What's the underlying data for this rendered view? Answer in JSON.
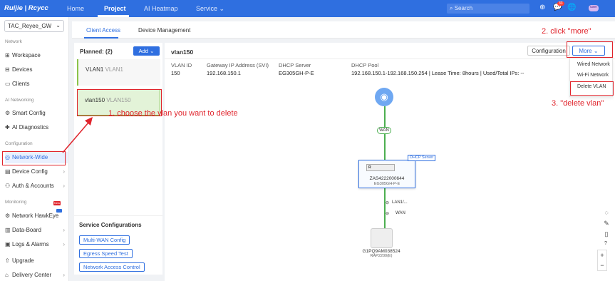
{
  "header": {
    "logo": "Ruijie | Rcycc",
    "nav": [
      "Home",
      "Project",
      "AI Heatmap",
      "Service"
    ],
    "search_placeholder": "Search",
    "notification_count": "33",
    "avatar_text": "user"
  },
  "sidebar": {
    "project_select": "TAC_Reyee_GW",
    "sections": {
      "network": "Network",
      "ai": "AI Networking",
      "configuration": "Configuration",
      "monitoring": "Monitoring"
    },
    "items": {
      "workspace": "Workspace",
      "devices": "Devices",
      "clients": "Clients",
      "smart_config": "Smart Config",
      "ai_diagnostics": "AI Diagnostics",
      "network_wide": "Network-Wide",
      "device_config": "Device Config",
      "auth_accounts": "Auth & Accounts",
      "hawkeye": "Network HawkEye",
      "data_board": "Data-Board",
      "logs_alarms": "Logs & Alarms",
      "upgrade": "Upgrade",
      "delivery_center": "Delivery Center"
    }
  },
  "tabs": [
    "Client Access",
    "Device Management"
  ],
  "vlan_list": {
    "planned_label": "Planned:",
    "planned_count": "(2)",
    "add_label": "Add",
    "items": [
      {
        "name": "VLAN1",
        "sub": "VLAN1"
      },
      {
        "name": "vlan150",
        "sub": "VLAN150"
      }
    ]
  },
  "service_config": {
    "title": "Service Configurations",
    "buttons": [
      "Multi-WAN Config",
      "Egress Speed Test",
      "Network Access Control"
    ],
    "new_tag": "New"
  },
  "detail": {
    "title": "vlan150",
    "configuration_label": "Configuration",
    "more_label": "More",
    "labels": [
      "VLAN ID",
      "Gateway IP Address (SVI)",
      "DHCP Server",
      "DHCP Pool"
    ],
    "values": [
      "150",
      "192.168.150.1",
      "EG305GH-P-E",
      "192.168.150.1-192.168.150.254  |  Lease Time:  8hours  |  Used/Total IPs:  --"
    ]
  },
  "dropdown": [
    "Wired Network",
    "Wi-Fi Network",
    "Delete VLAN"
  ],
  "annotations": {
    "step1": "1. choose the vlan you want to delete",
    "step2": "2. click \"more\"",
    "step3": "3. \"delete vlan\""
  },
  "topology": {
    "wan_label": "WAN",
    "gateway_tag": "DHCP Server",
    "gateway_inner": "R",
    "gateway_sn": "ZAS4222000644",
    "gateway_model": "EG305GH-P-E",
    "port1": "LAN1/...",
    "port2": "WAN",
    "ap_sn": "G1PQ9AM038524",
    "ap_model": "RAP2200(E)"
  },
  "colors": {
    "accent": "#2f6fe0",
    "annotation": "#e0242c",
    "link": "#4caf50"
  }
}
